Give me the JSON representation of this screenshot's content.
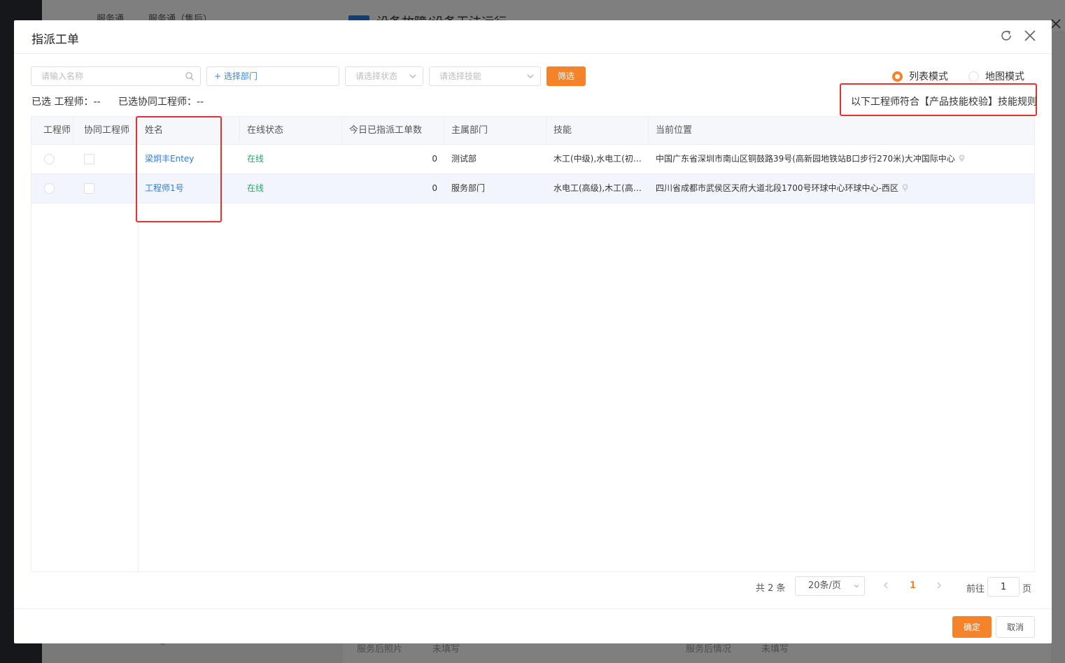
{
  "background": {
    "crumbs": [
      "服务通",
      "服务通（售后）"
    ],
    "title": "设备故障/设备无法运行",
    "bottom_fields": [
      "服务后照片",
      "未填写",
      "服务后情况",
      "未填写"
    ]
  },
  "dialog": {
    "title": "指派工单",
    "refresh_icon": "refresh-icon",
    "close_icon": "close-icon"
  },
  "filters": {
    "name_placeholder": "请输入名称",
    "dept_label": "+ 选择部门",
    "status_placeholder": "请选择状态",
    "skill_placeholder": "请选择技能",
    "filter_button": "筛选"
  },
  "modes": {
    "list_label": "列表模式",
    "map_label": "地图模式",
    "selected": "list"
  },
  "selected": {
    "engineer": "已选 工程师：--",
    "assist": "已选协同工程师：--"
  },
  "rule_note": "以下工程师符合【产品技能校验】技能规则",
  "table": {
    "columns": [
      "工程师",
      "协同工程师",
      "姓名",
      "在线状态",
      "今日已指派工单数",
      "主属部门",
      "技能",
      "当前位置"
    ],
    "rows": [
      {
        "name": "梁炯丰Entey",
        "status": "在线",
        "count": "0",
        "dept": "测试部",
        "skills": "木工(中级),水电工(初级)",
        "location": "中国广东省深圳市南山区铜鼓路39号(高新园地铁站B口步行270米)大冲国际中心"
      },
      {
        "name": "工程师1号",
        "status": "在线",
        "count": "0",
        "dept": "服务部门",
        "skills": "水电工(高级),木工(高级)",
        "location": "四川省成都市武侯区天府大道北段1700号环球中心环球中心-西区"
      }
    ]
  },
  "pagination": {
    "total": "共 2 条",
    "page_size": "20条/页",
    "current": "1",
    "goto_label": "前往",
    "goto_value": "1",
    "page_suffix": "页"
  },
  "footer": {
    "ok": "确定",
    "cancel": "取消"
  },
  "colors": {
    "accent": "#f5832a",
    "link": "#2f7bd1",
    "online": "#27a36a",
    "highlight_border": "#e5322d"
  }
}
